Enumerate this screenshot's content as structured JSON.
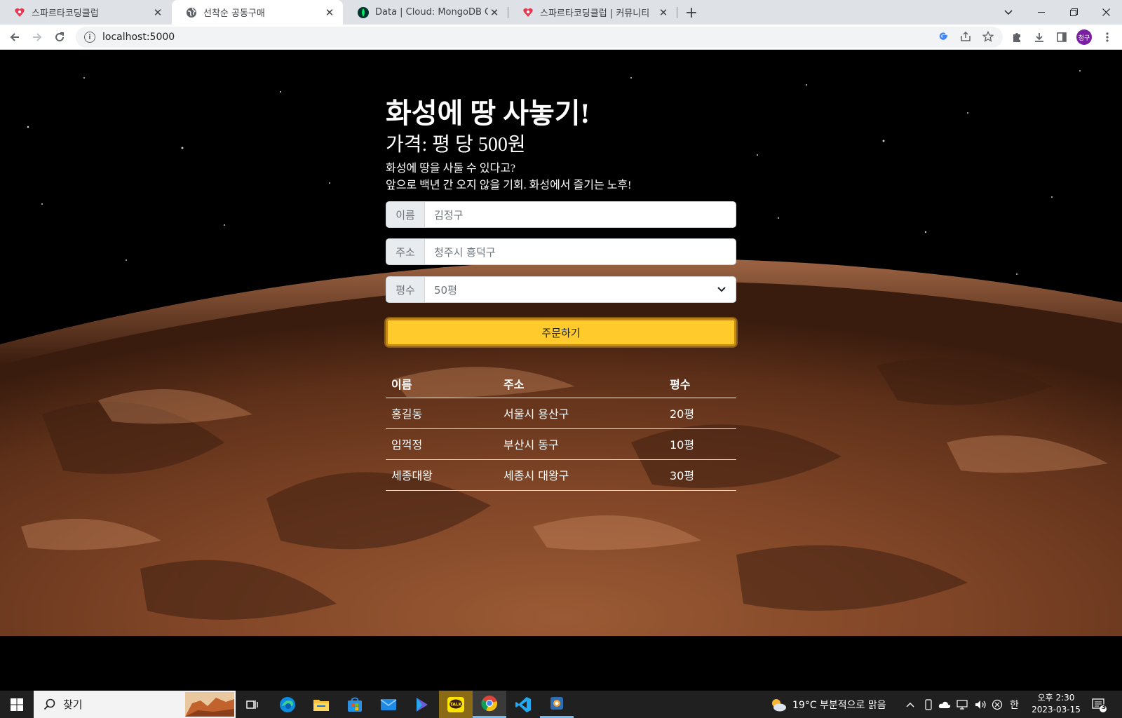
{
  "browser": {
    "tabs": [
      {
        "title": "스파르타코딩클럽",
        "icon": "sparta-favicon",
        "active": false
      },
      {
        "title": "선착순 공동구매",
        "icon": "globe-icon",
        "active": true
      },
      {
        "title": "Data | Cloud: MongoDB Cloud",
        "icon": "mongodb-leaf-icon",
        "active": false
      },
      {
        "title": "스파르타코딩클럽 | 커뮤니티",
        "icon": "sparta-favicon",
        "active": false
      }
    ],
    "url": "localhost:5000",
    "profile_initials": "청구"
  },
  "page": {
    "title": "화성에 땅 사놓기!",
    "price": "가격: 평 당 500원",
    "desc_line1": "화성에 땅을 사둘 수 있다고?",
    "desc_line2": "앞으로 백년 간 오지 않을 기회. 화성에서 즐기는 노후!",
    "form": {
      "name_label": "이름",
      "name_value": "김정구",
      "address_label": "주소",
      "address_value": "청주시 흥덕구",
      "size_label": "평수",
      "size_value": "50평",
      "submit_label": "주문하기"
    },
    "table": {
      "headers": [
        "이름",
        "주소",
        "평수"
      ],
      "rows": [
        [
          "홍길동",
          "서울시 용산구",
          "20평"
        ],
        [
          "임꺽정",
          "부산시 동구",
          "10평"
        ],
        [
          "세종대왕",
          "세종시 대왕구",
          "30평"
        ]
      ]
    },
    "colors": {
      "accent_button": "#ffca2c",
      "button_border": "#c78a14"
    }
  },
  "taskbar": {
    "search_label": "찾기",
    "weather": "19°C  부분적으로 맑음",
    "ime": "한",
    "time": "오후 2:30",
    "date": "2023-03-15",
    "notification_count": "3"
  }
}
